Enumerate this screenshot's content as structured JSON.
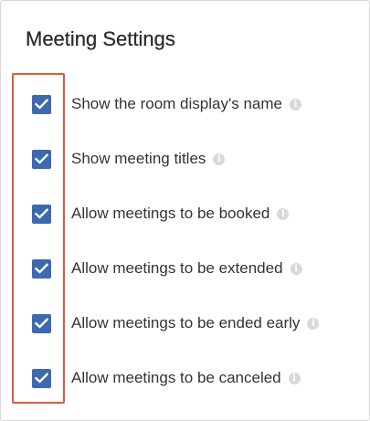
{
  "panel": {
    "title": "Meeting Settings"
  },
  "settings": [
    {
      "label": "Show the room display's name",
      "checked": true,
      "info_icon": "info-icon"
    },
    {
      "label": "Show meeting titles",
      "checked": true,
      "info_icon": "info-icon"
    },
    {
      "label": "Allow meetings to be booked",
      "checked": true,
      "info_icon": "info-icon"
    },
    {
      "label": "Allow meetings to be extended",
      "checked": true,
      "info_icon": "info-icon"
    },
    {
      "label": "Allow meetings to be ended early",
      "checked": true,
      "info_icon": "info-icon"
    },
    {
      "label": "Allow meetings to be canceled",
      "checked": true,
      "info_icon": "info-icon"
    }
  ],
  "icons": {
    "info_glyph": "i"
  },
  "colors": {
    "checkbox": "#3d69b1",
    "highlight_border": "#dc5a3f",
    "info_icon": "#d9d9d9",
    "text": "#333333"
  }
}
